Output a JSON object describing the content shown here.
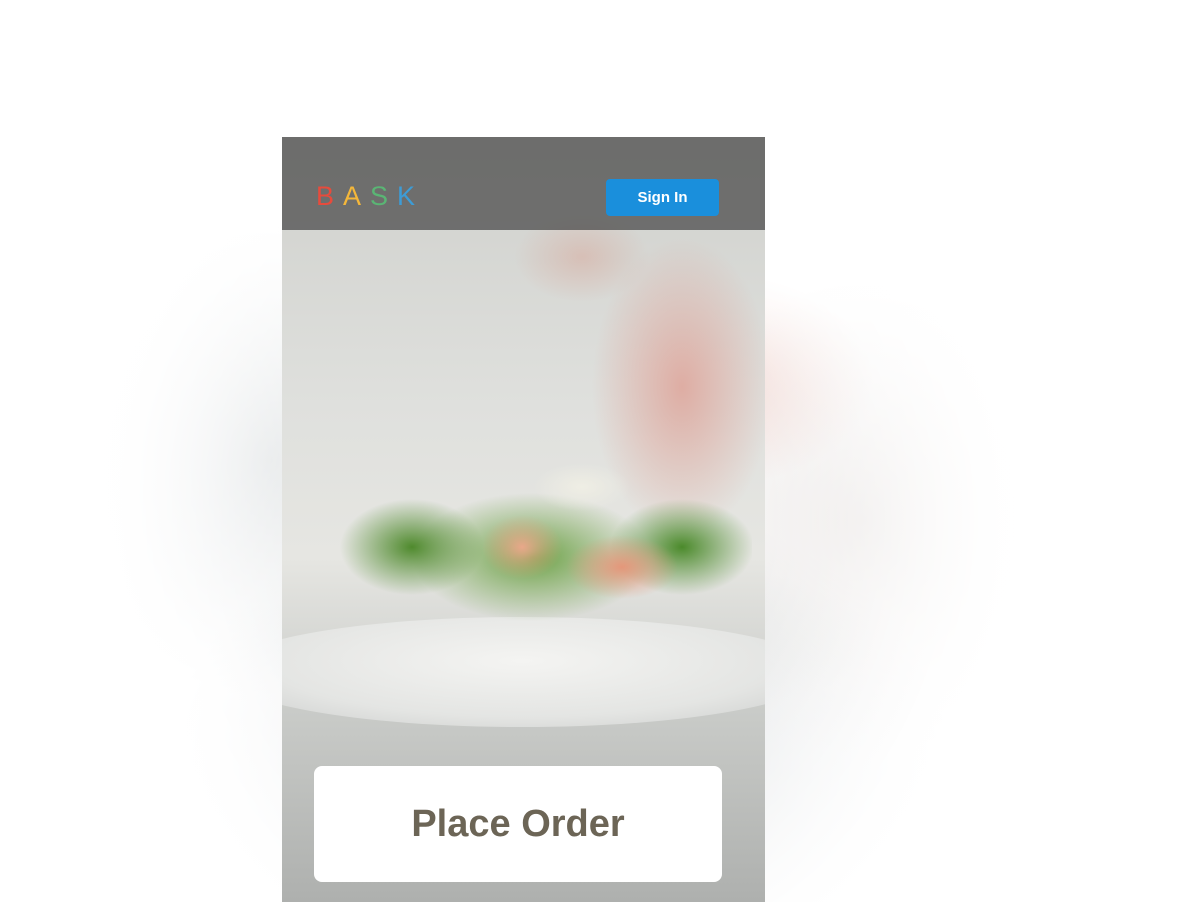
{
  "header": {
    "logo_letters": [
      {
        "char": "B",
        "color": "#e74b3c"
      },
      {
        "char": "A",
        "color": "#f4b73a"
      },
      {
        "char": "S",
        "color": "#5ab574"
      },
      {
        "char": "K",
        "color": "#3d9cd6"
      }
    ],
    "sign_in_label": "Sign In"
  },
  "main": {
    "place_order_label": "Place Order"
  },
  "colors": {
    "sign_in_button": "#1a8fdc",
    "place_order_text": "#6c6556",
    "header_overlay": "#464646"
  }
}
